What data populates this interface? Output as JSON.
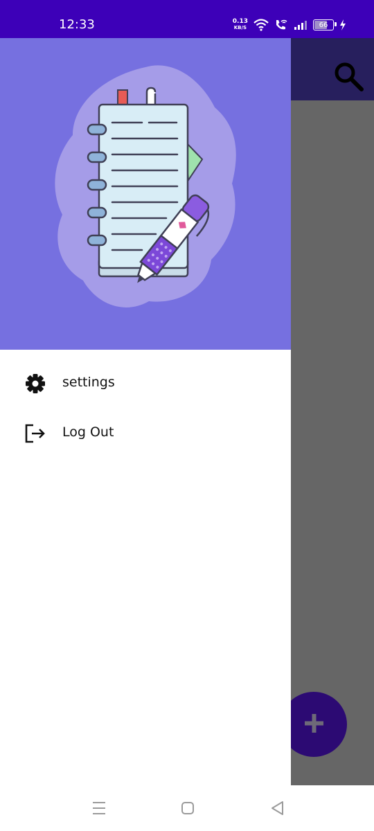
{
  "status_bar": {
    "time": "12:33",
    "net_speed_value": "0.13",
    "net_speed_unit": "KB/S",
    "battery": "66",
    "color": "#3d00b8"
  },
  "toolbar": {
    "search_icon": "search-icon",
    "color": "#271f5d"
  },
  "drawer": {
    "header_color": "#7670e0",
    "items": [
      {
        "label": "settings",
        "icon": "gear-icon"
      },
      {
        "label": "Log Out",
        "icon": "logout-icon"
      }
    ]
  },
  "fab": {
    "icon": "plus-icon",
    "color": "#2c0a73"
  },
  "nav_bar": {
    "buttons": [
      "menu-icon",
      "home-icon",
      "back-icon"
    ]
  }
}
